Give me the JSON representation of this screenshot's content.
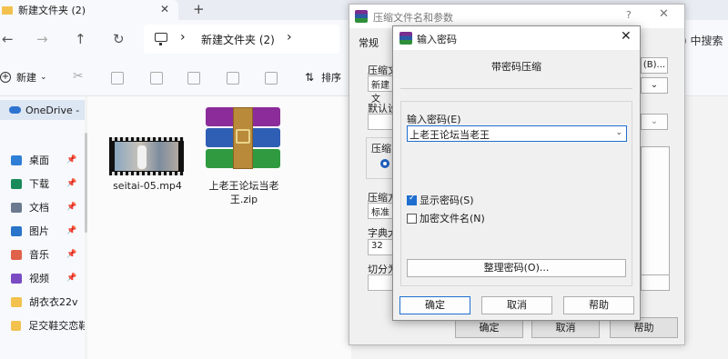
{
  "explorer": {
    "tab_title": "新建文件夹 (2)",
    "breadcrumb": "新建文件夹 (2)",
    "search_fragment": ") 中搜索",
    "new_label": "新建",
    "sort_label": "排序",
    "sidebar": {
      "onedrive": "OneDrive -",
      "items": [
        {
          "label": "桌面",
          "icon": "desktop-icon",
          "color": "#2f7fd6",
          "pinned": true
        },
        {
          "label": "下载",
          "icon": "download-icon",
          "color": "#1a8a5a",
          "pinned": true
        },
        {
          "label": "文档",
          "icon": "document-icon",
          "color": "#6b7a8f",
          "pinned": true
        },
        {
          "label": "图片",
          "icon": "pictures-icon",
          "color": "#2a74c9",
          "pinned": true
        },
        {
          "label": "音乐",
          "icon": "music-icon",
          "color": "#e0624a",
          "pinned": true
        },
        {
          "label": "视频",
          "icon": "video-icon",
          "color": "#7b4bc4",
          "pinned": true
        },
        {
          "label": "胡衣衣22v",
          "icon": "folder-icon",
          "color": "#f2c14e",
          "pinned": false
        },
        {
          "label": "足交鞋交恋鞋",
          "icon": "folder-icon",
          "color": "#f2c14e",
          "pinned": false
        }
      ]
    },
    "files": [
      {
        "name": "seitai-05.mp4",
        "icon": "video-file-icon"
      },
      {
        "name_line1": "上老王论坛当老",
        "name_line2": "王.zip",
        "icon": "winrar-archive-icon"
      }
    ]
  },
  "archive_dialog": {
    "title": "压缩文件名和参数",
    "help_glyph": "?",
    "tab_general": "常规",
    "label_archive_name": "压缩文",
    "archive_name_value": "新建文",
    "browse_label": "(B)...",
    "label_profile": "默认设",
    "label_format": "压缩",
    "label_method": "压缩方",
    "method_value": "标准",
    "label_dict": "字典大",
    "dict_value": "32",
    "label_split": "切分为",
    "ok": "确定",
    "cancel": "取消",
    "help": "帮助"
  },
  "password_dialog": {
    "title": "输入密码",
    "heading": "带密码压缩",
    "input_label": "输入密码(E)",
    "password_value": "上老王论坛当老王",
    "show_password_label": "显示密码(S)",
    "show_password_checked": true,
    "encrypt_names_label": "加密文件名(N)",
    "encrypt_names_checked": false,
    "manage_label": "整理密码(O)...",
    "ok": "确定",
    "cancel": "取消",
    "help": "帮助"
  }
}
